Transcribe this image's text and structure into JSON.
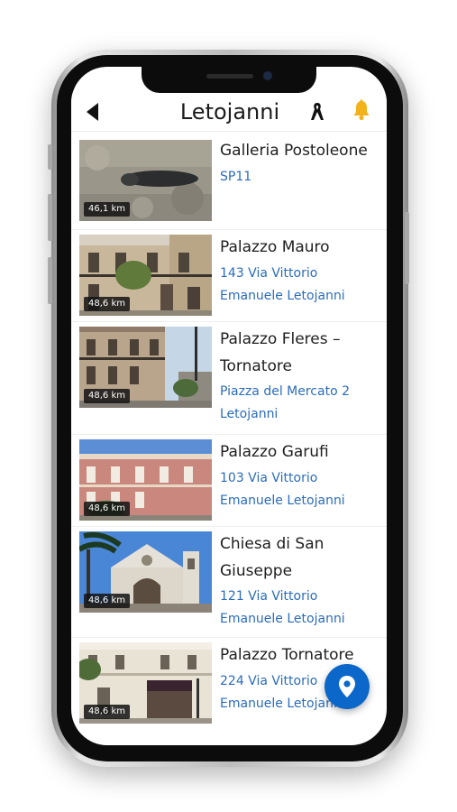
{
  "header": {
    "title": "Letojanni",
    "back_icon": "back-arrow-icon",
    "ribbon_icon": "mourning-ribbon-icon",
    "bell_icon": "bell-icon"
  },
  "colors": {
    "accent": "#0b67c9",
    "address_link": "#2a6cbc",
    "bell": "#f2b21b"
  },
  "places": [
    {
      "name_lines": [
        "Galleria Postoleone"
      ],
      "address_lines": [
        "SP11"
      ],
      "distance": "46,1 km"
    },
    {
      "name_lines": [
        "Palazzo Mauro"
      ],
      "address_lines": [
        "143 Via Vittorio",
        "Emanuele Letojanni"
      ],
      "distance": "48,6 km"
    },
    {
      "name_lines": [
        "Palazzo Fleres –",
        "Tornatore"
      ],
      "address_lines": [
        "Piazza del Mercato 2",
        "Letojanni"
      ],
      "distance": "48,6 km"
    },
    {
      "name_lines": [
        "Palazzo Garufi"
      ],
      "address_lines": [
        "103 Via Vittorio",
        "Emanuele Letojanni"
      ],
      "distance": "48,6 km"
    },
    {
      "name_lines": [
        "Chiesa di San",
        "Giuseppe"
      ],
      "address_lines": [
        "121 Via Vittorio",
        "Emanuele Letojanni"
      ],
      "distance": "48,6 km"
    },
    {
      "name_lines": [
        "Palazzo Tornatore"
      ],
      "address_lines": [
        "224 Via Vittorio",
        "Emanuele Letojanni"
      ],
      "distance": "48,6 km"
    }
  ],
  "fab": {
    "icon": "map-pin-icon"
  }
}
